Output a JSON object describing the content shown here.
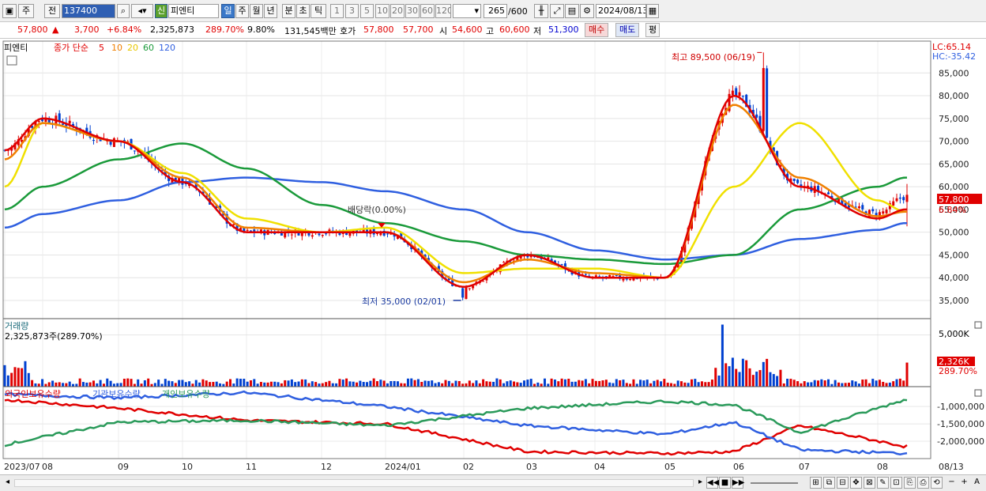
{
  "toolbar": {
    "code": "137400",
    "stock_name": "피엔티",
    "badge": "신",
    "period_labels": [
      "일",
      "주",
      "월",
      "년",
      "분",
      "초",
      "틱"
    ],
    "minute_labels": [
      "1",
      "3",
      "5",
      "10",
      "20",
      "30",
      "60",
      "120"
    ],
    "count": "265",
    "count_total": "/600",
    "date": "2024/08/13",
    "left_labels": [
      "주",
      "전"
    ]
  },
  "quote": {
    "price": "57,800",
    "arrow": "▲",
    "change": "3,700",
    "rate": "+6.84%",
    "volume": "2,325,873",
    "vol_ratio": "289.70%",
    "turnover_rate": "9.80%",
    "amount": "131,545백만",
    "hoga_label": "호가",
    "ask": "57,800",
    "bid": "57,700",
    "open_label": "시",
    "open": "54,600",
    "high_label": "고",
    "high": "60,600",
    "low_label": "저",
    "low": "51,300",
    "buy_label": "매수",
    "sell_label": "매도",
    "avg_label": "평"
  },
  "price_pane": {
    "title": "피엔티",
    "ma_prefix": "종가 단순",
    "ma_labels": [
      "5",
      "10",
      "20",
      "60",
      "120"
    ],
    "lc": "LC:65.14",
    "hc": "HC:-35.42",
    "high_annot": "최고 89,500 (06/19)",
    "low_annot": "최저 35,000 (02/01)",
    "div_annot": "배당락(0.00%)",
    "last_price_tag": "57,800",
    "last_rate_tag": "6.84%"
  },
  "volume_pane": {
    "title": "거래량",
    "value": "2,325,873주(289.70%)",
    "tag_value": "2,326K",
    "tag_rate": "289.70%",
    "axis_label": "5,000K"
  },
  "holding_pane": {
    "labels": [
      "외국인보유수량",
      "기관보유수량",
      "개인보유수량"
    ]
  },
  "xaxis": {
    "labels": [
      "2023/07",
      "08",
      "09",
      "10",
      "11",
      "12",
      "2024/01",
      "02",
      "03",
      "04",
      "05",
      "06",
      "07",
      "08",
      "08/13"
    ]
  },
  "colors": {
    "up": "#e00000",
    "down": "#0040d0",
    "ma5": "#e00000",
    "ma10": "#f08000",
    "ma20": "#f0e000",
    "ma60": "#1a9a3a",
    "ma120": "#2f5fe0",
    "foreign": "#e00000",
    "inst": "#2f5fe0",
    "indiv": "#2a9a5a"
  },
  "chart_data": [
    {
      "type": "candlestick",
      "title": "피엔티",
      "ylabel": "",
      "yticks": [
        35000,
        40000,
        45000,
        50000,
        55000,
        60000,
        65000,
        70000,
        75000,
        80000,
        85000
      ],
      "ylim": [
        31000,
        92000
      ],
      "x": [
        "2023-07",
        "2023-08",
        "2023-09",
        "2023-10",
        "2023-11",
        "2023-12",
        "2024-01",
        "2024-02",
        "2024-03",
        "2024-04",
        "2024-05",
        "2024-06",
        "2024-07",
        "2024-08",
        "2024-08-13"
      ],
      "close": [
        68000,
        75000,
        70000,
        61000,
        50000,
        50000,
        50000,
        38000,
        45000,
        40000,
        40000,
        80000,
        60000,
        54100,
        57800
      ],
      "series": [
        {
          "name": "5",
          "values": [
            68000,
            75000,
            70000,
            61000,
            50000,
            50000,
            50000,
            38000,
            45000,
            40000,
            40000,
            80000,
            60000,
            53000,
            55000
          ]
        },
        {
          "name": "10",
          "values": [
            66000,
            74000,
            70000,
            62000,
            51000,
            50000,
            50000,
            39000,
            44000,
            41000,
            40000,
            78000,
            62000,
            53500,
            54500
          ]
        },
        {
          "name": "20",
          "values": [
            60000,
            74000,
            70000,
            63000,
            53000,
            50000,
            51000,
            41000,
            42000,
            42000,
            40000,
            60000,
            74000,
            57000,
            54500
          ]
        },
        {
          "name": "60",
          "values": [
            55000,
            60000,
            66000,
            69500,
            64000,
            56000,
            52000,
            48000,
            45000,
            44000,
            43000,
            45000,
            55000,
            60000,
            62000
          ]
        },
        {
          "name": "120",
          "values": [
            51000,
            54000,
            57000,
            61000,
            62000,
            61000,
            59000,
            55000,
            50000,
            46000,
            44000,
            45000,
            48500,
            50500,
            52000
          ]
        }
      ],
      "annotations": {
        "high": {
          "date": "06/19",
          "value": 89500
        },
        "low": {
          "date": "02/01",
          "value": 35000
        }
      }
    },
    {
      "type": "bar",
      "title": "거래량",
      "ylabel": "",
      "yticks": [
        5000000
      ],
      "last_value": 2325873
    },
    {
      "type": "line",
      "title": "",
      "yticks": [
        -1000000,
        -1500000,
        -2000000
      ],
      "x": [
        "2023-07",
        "2023-09",
        "2023-11",
        "2024-01",
        "2024-03",
        "2024-05",
        "2024-06",
        "2024-07",
        "2024-08-13"
      ],
      "series": [
        {
          "name": "외국인보유수량",
          "values": [
            -800000,
            -1050000,
            -1400000,
            -1500000,
            -2300000,
            -2350000,
            -2300000,
            -1550000,
            -2150000
          ]
        },
        {
          "name": "기관보유수량",
          "values": [
            -650000,
            -750000,
            -600000,
            -1000000,
            -1550000,
            -1800000,
            -1450000,
            -2250000,
            -2350000
          ]
        },
        {
          "name": "개인보유수량",
          "values": [
            -2100000,
            -1450000,
            -1400000,
            -1550000,
            -1050000,
            -850000,
            -950000,
            -1750000,
            -800000
          ]
        }
      ]
    }
  ]
}
